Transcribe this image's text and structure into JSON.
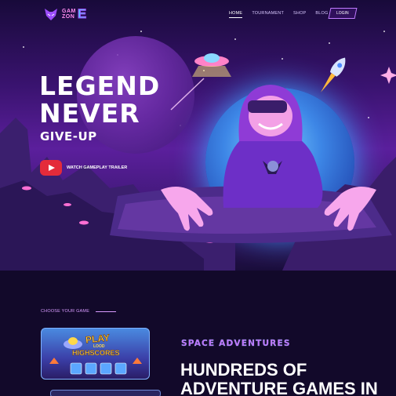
{
  "nav": {
    "logo_line1": "GAM",
    "logo_line2": "ZON",
    "logo_e": "E",
    "items": [
      {
        "label": "HOME",
        "active": true
      },
      {
        "label": "TOURNAMENT",
        "active": false
      },
      {
        "label": "SHOP",
        "active": false
      },
      {
        "label": "BLOG",
        "active": false
      }
    ],
    "login": "LOGIN"
  },
  "hero": {
    "line1": "LEGEND",
    "line2": "NEVER",
    "line3": "GIVE-UP",
    "trailer_label": "WATCH GAMEPLAY TRAILER"
  },
  "games": {
    "section_label": "CHOOSE YOUR GAME",
    "card": {
      "title": "PLAY",
      "sub1": "LOOD",
      "sub2": "HIGHSCORES"
    }
  },
  "feature": {
    "tag": "SPACE ADVENTURES",
    "heading_line1": "HUNDREDS OF",
    "heading_line2": "ADVENTURE GAMES IN"
  },
  "colors": {
    "accent": "#c46cff",
    "play_red": "#e42b3a",
    "background": "#12092a"
  }
}
